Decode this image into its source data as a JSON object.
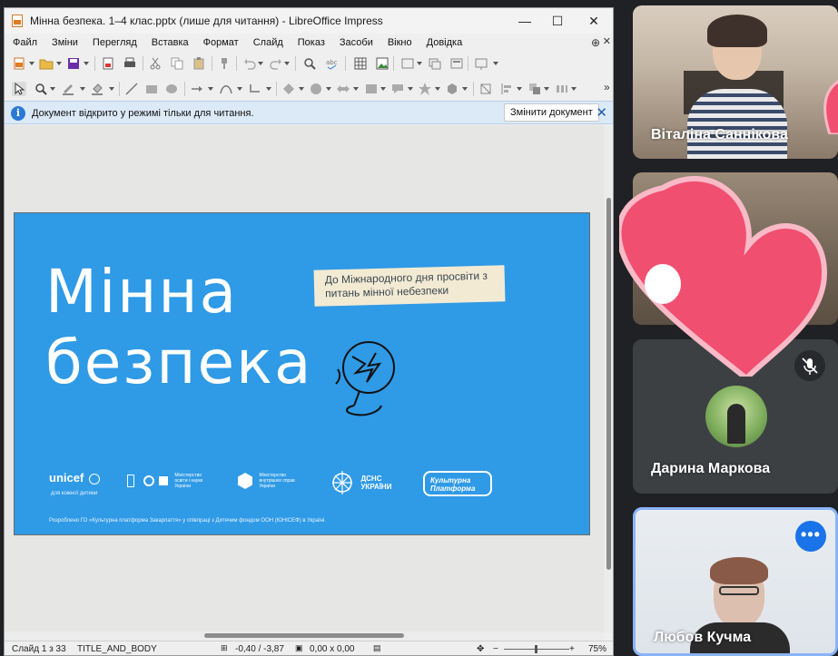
{
  "window": {
    "title": "Мінна безпека. 1–4 клас.pptx (лише для читання) - LibreOffice Impress",
    "minimize": "—",
    "maximize": "☐",
    "close": "✕"
  },
  "menu": [
    "Файл",
    "Зміни",
    "Перегляд",
    "Вставка",
    "Формат",
    "Слайд",
    "Показ",
    "Засоби",
    "Вікно",
    "Довідка"
  ],
  "infobar": {
    "icon": "i",
    "message": "Документ відкрито у режимі тільки для читання.",
    "edit_button": "Змінити документ",
    "close": "✕"
  },
  "slide": {
    "title_line1": "Мінна",
    "title_line2": "безпека",
    "note": "До Міжнародного дня просвіти з питань мінної небезпеки",
    "partners": {
      "unicef": "unicef",
      "unicef_tagline": "для кожної дитини",
      "ministry_edu": "Міністерство освіти і науки України",
      "ministry_int": "Міністерство внутрішніх справ України",
      "dsns": "ДСНС УКРАЇНИ",
      "kultura": "Культурна Платформа"
    },
    "footnote": "Розроблено ГО «Культурна платформа Закарпаття» у співпраці з Дитячим фондом ООН (ЮНІСЕФ) в Україні."
  },
  "status": {
    "slide_pos": "Слайд 1 з 33",
    "layout": "TITLE_AND_BODY",
    "position": "-0,40 / -3,87",
    "size": "0,00 x 0,00",
    "zoom": "75%"
  },
  "participants": [
    {
      "name": "Віталіна Саннікова"
    },
    {
      "name": "Дарина Маркова"
    },
    {
      "name": "Любов Кучма"
    }
  ],
  "icons": {
    "more": "•••"
  }
}
